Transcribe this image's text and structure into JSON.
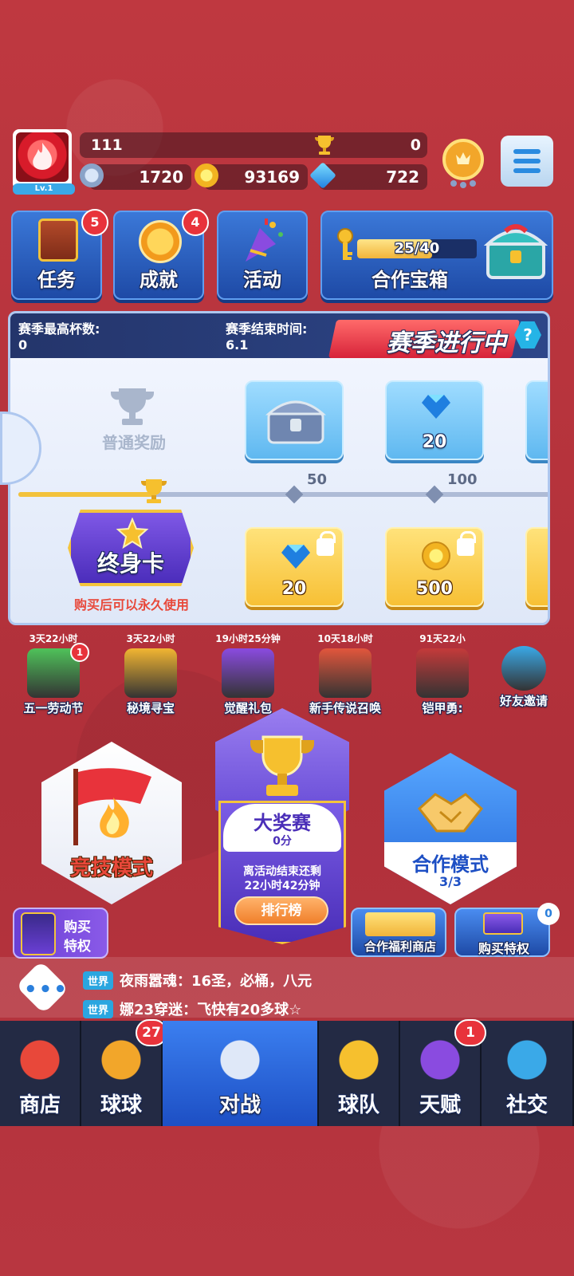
{
  "player": {
    "level": "Lv.1",
    "name": "111",
    "trophies": "0"
  },
  "resources": {
    "stars": "1720",
    "coins": "93169",
    "gems": "722"
  },
  "tiles": {
    "tasks": {
      "label": "任务",
      "badge": "5"
    },
    "achievements": {
      "label": "成就",
      "badge": "4"
    },
    "activity": {
      "label": "活动"
    },
    "coop_chest": {
      "label": "合作宝箱",
      "progress_text": "25/40",
      "progress": 0.625
    }
  },
  "season": {
    "best_cups_label": "赛季最高杯数:",
    "best_cups_value": "0",
    "end_time_label": "赛季结束时间:",
    "end_time_value": "6.1",
    "status_title": "赛季进行中",
    "help": "?",
    "normal_reward_label": "普通奖励",
    "milestones": [
      "50",
      "100"
    ],
    "normal_rewards": [
      {
        "type": "chest"
      },
      {
        "type": "gem",
        "amount": "20"
      }
    ],
    "premium_rewards": [
      {
        "type": "gem",
        "amount": "20"
      },
      {
        "type": "coin",
        "amount": "500"
      }
    ],
    "lifetime_card_label": "终身卡",
    "lifetime_desc": "购买后可以永久使用",
    "progress": 0.25
  },
  "events": [
    {
      "timer": "3天22小时",
      "label": "五一劳动节",
      "badge": "1",
      "color": "#4fc25a"
    },
    {
      "timer": "3天22小时",
      "label": "秘境寻宝",
      "color": "#f2b532"
    },
    {
      "timer": "19小时25分钟",
      "label": "觉醒礼包",
      "color": "#8a4be0"
    },
    {
      "timer": "10天18小时",
      "label": "新手传说召唤",
      "color": "#e2563c"
    },
    {
      "timer": "91天22小",
      "label": "铠甲勇:",
      "color": "#c43a3a"
    },
    {
      "timer": "",
      "label": "好友邀请",
      "color": "#3aa9e8"
    }
  ],
  "modes": {
    "competitive": {
      "label": "竞技模式"
    },
    "grand_prix": {
      "title": "大奖赛",
      "score": "0分",
      "countdown_line1": "离活动结束还剩",
      "countdown_line2": "22小时42分钟",
      "rank_button": "排行榜"
    },
    "coop": {
      "label": "合作模式",
      "count": "3/3"
    }
  },
  "side_buttons": {
    "buy_privilege_left": {
      "line1": "购买",
      "line2": "特权"
    },
    "coop_shop": "合作福利商店",
    "buy_privilege_right": {
      "label": "购买特权",
      "badge": "0"
    }
  },
  "chat": [
    {
      "tag": "世界",
      "text": "夜雨嚣魂：16圣，必桶，八元"
    },
    {
      "tag": "世界",
      "text": "娜23穿迷：飞快有20多球☆"
    }
  ],
  "chat_button": "•••",
  "nav": [
    {
      "label": "商店",
      "icon": "shop-icon"
    },
    {
      "label": "球球",
      "icon": "ball-icon",
      "badge": "27"
    },
    {
      "label": "对战",
      "icon": "battle-icon",
      "active": true
    },
    {
      "label": "球队",
      "icon": "whistle-icon"
    },
    {
      "label": "天赋",
      "icon": "talent-icon",
      "badge": "1"
    },
    {
      "label": "社交",
      "icon": "social-icon"
    }
  ],
  "colors": {
    "background": "#b8323a",
    "panel_blue": "#2d4689",
    "accent_gold": "#f3c23b",
    "nav_active": "#2f6ee0"
  }
}
